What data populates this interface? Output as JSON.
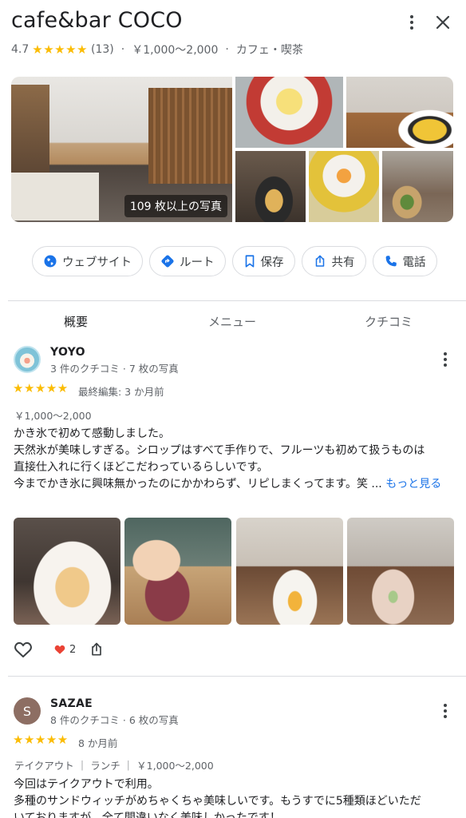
{
  "header": {
    "title": "cafe&bar COCO",
    "rating": "4.7",
    "stars": "★★★★★",
    "review_count": "(13)",
    "price_range": "￥1,000〜2,000",
    "category": "カフェ・喫茶",
    "separator": "·"
  },
  "photos": {
    "count_label": "109 枚以上の写真"
  },
  "actions": [
    {
      "label": "ウェブサイト",
      "icon": "globe-icon"
    },
    {
      "label": "ルート",
      "icon": "directions-icon"
    },
    {
      "label": "保存",
      "icon": "bookmark-icon"
    },
    {
      "label": "共有",
      "icon": "share-icon"
    },
    {
      "label": "電話",
      "icon": "phone-icon"
    }
  ],
  "tabs": [
    {
      "label": "概要",
      "active": true
    },
    {
      "label": "メニュー",
      "active": false
    },
    {
      "label": "クチコミ",
      "active": false
    }
  ],
  "reviews": [
    {
      "name": "YOYO",
      "subtitle": "3 件のクチコミ · 7 枚の写真",
      "stars": "★★★★★",
      "time": "最終編集: 3 か月前",
      "tags": "￥1,000〜2,000",
      "lines": [
        "かき氷で初めて感動しました。",
        "天然氷が美味しすぎる。シロップはすべて手作りで、フルーツも初めて扱うものは",
        "直接仕入れに行くほどこだわっているらしいです。",
        "今までかき氷に興味無かったのにかかわらず、リピしまくってます。笑 ..."
      ],
      "more_label": "もっと見る",
      "reaction_count": "2"
    },
    {
      "name": "SAZAE",
      "avatar_letter": "S",
      "subtitle": "8 件のクチコミ · 6 枚の写真",
      "stars": "★★★★★",
      "time": "8 か月前",
      "tags": "テイクアウト ｜ ランチ ｜ ￥1,000〜2,000",
      "lines": [
        "今回はテイクアウトで利用。",
        "多種のサンドウィッチがめちゃくちゃ美味しいです。もうすでに5種類ほどいただ",
        "いておりますが、全て間違いなく美味しかったです！"
      ]
    }
  ],
  "colors": {
    "accent": "#1a73e8",
    "star": "#fbbc04",
    "heart": "#ea4335"
  }
}
